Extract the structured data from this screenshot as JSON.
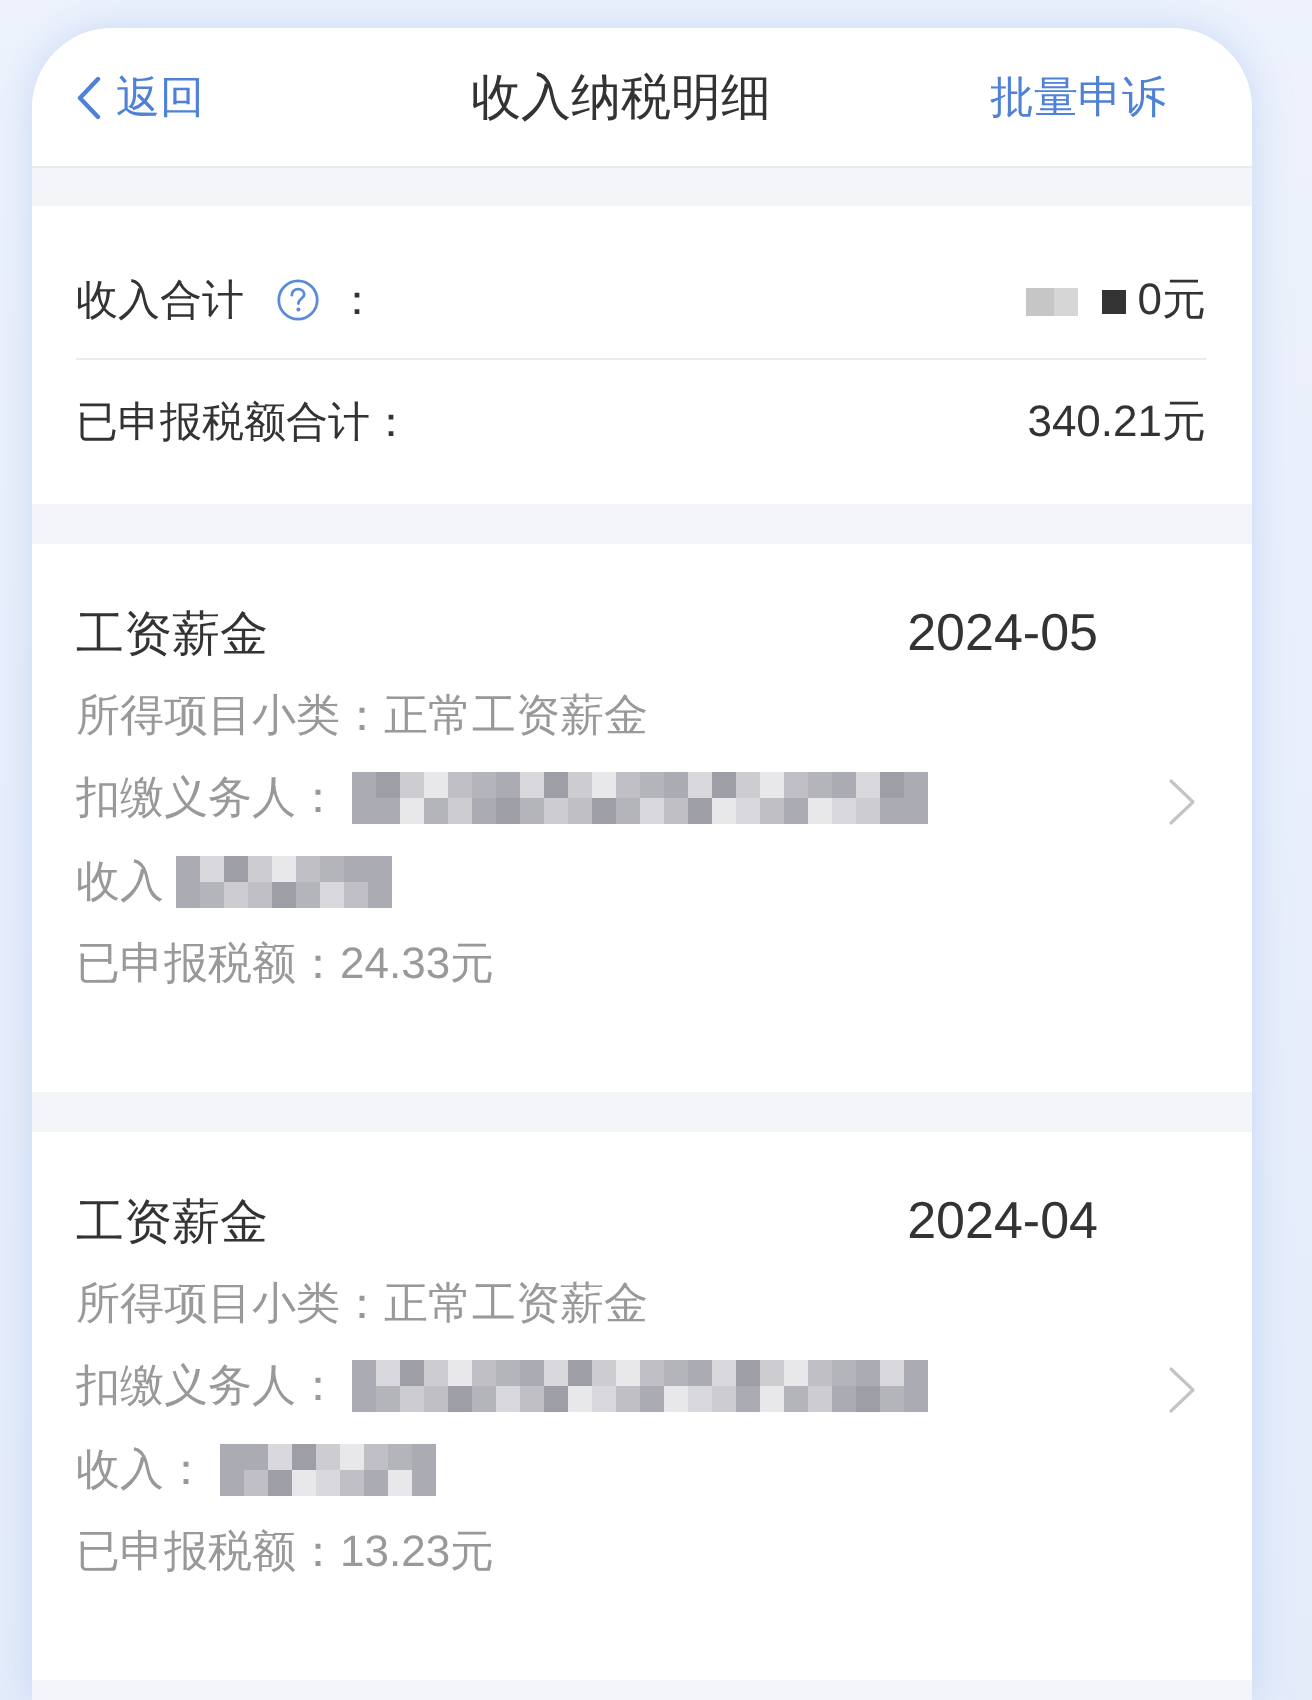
{
  "nav_bar": {
    "back": "返回",
    "title": "收入纳税明细",
    "action": "批量申诉"
  },
  "summary": [
    {
      "label": "收入合计",
      "help": true,
      "label_end": "：",
      "redacted": true,
      "value": "0元"
    },
    {
      "label": "已申报税额合计：",
      "help": false,
      "redacted": false,
      "value": "340.21元"
    }
  ],
  "records": [
    {
      "category": "工资薪金",
      "period": "2024-05",
      "fields": [
        {
          "label": "所得项目小类：",
          "redacted": false,
          "value": "正常工资薪金"
        },
        {
          "label": "扣缴义务人：",
          "redacted": true
        },
        {
          "label": "收入",
          "redacted": true
        },
        {
          "label": "已申报税额：",
          "redacted": false,
          "value": "24.33元"
        }
      ]
    },
    {
      "category": "工资薪金",
      "period": "2024-04",
      "fields": [
        {
          "label": "所得项目小类：",
          "redacted": false,
          "value": "正常工资薪金"
        },
        {
          "label": "扣缴义务人：",
          "redacted": true
        },
        {
          "label": "收入：",
          "redacted": true
        },
        {
          "label": "已申报税额：",
          "redacted": false,
          "value": "13.23元"
        }
      ]
    }
  ]
}
